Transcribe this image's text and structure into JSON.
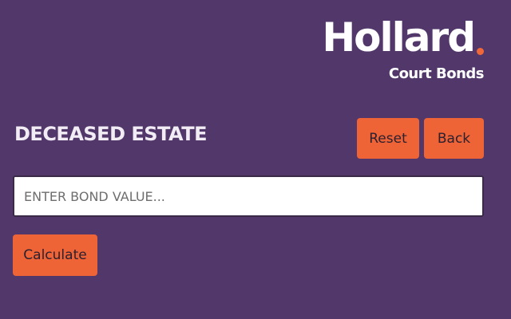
{
  "brand": {
    "logo_text": "Hollard",
    "subtitle": "Court Bonds",
    "accent_color": "#f0683a"
  },
  "page": {
    "title": "DECEASED ESTATE",
    "background_color": "#52386a"
  },
  "actions": {
    "reset_label": "Reset",
    "back_label": "Back",
    "calculate_label": "Calculate",
    "button_color": "#ef6436"
  },
  "bond_input": {
    "value": "",
    "placeholder": "ENTER BOND VALUE..."
  }
}
